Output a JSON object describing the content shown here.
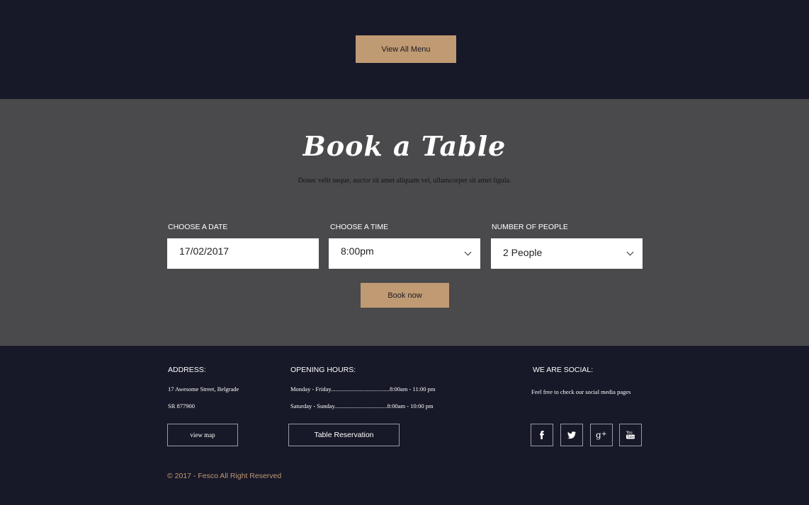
{
  "top": {
    "view_menu_label": "View All Menu"
  },
  "booking": {
    "title": "Book a Table",
    "subtitle": "Donec velit neque, auctor sit amet aliquam vel, ullamcorper sit amet ligula.",
    "date_label": "CHOOSE A DATE",
    "date_value": "17/02/2017",
    "time_label": "CHOOSE A TIME",
    "time_value": "8:00pm",
    "people_label": "NUMBER OF PEOPLE",
    "people_value": "2 People",
    "submit_label": "Book now"
  },
  "footer": {
    "address_heading": "ADDRESS:",
    "address_line1": "17 Awesome Street, Belgrade",
    "address_line2": "SR 877900",
    "view_map_label": "view map",
    "hours_heading": "OPENING HOURS:",
    "hours": [
      {
        "days": "Monday - Friday",
        "dots": ".......................................",
        "time": "8:00am - 11:00 pm"
      },
      {
        "days": "Saturday - Sunday",
        "dots": "...................................",
        "time": "8:00am - 10:00 pm"
      }
    ],
    "reservation_label": "Table Reservation",
    "social_heading": "WE ARE SOCIAL:",
    "social_text": "Feel free to check our social media pages",
    "social_icons": [
      "facebook-icon",
      "twitter-icon",
      "google-plus-icon",
      "youtube-icon"
    ],
    "copyright": "© 2017 - Fesco All Right Reserved"
  },
  "colors": {
    "dark_bg": "#171828",
    "section_bg": "#4a4a4c",
    "accent": "#c09a73"
  }
}
